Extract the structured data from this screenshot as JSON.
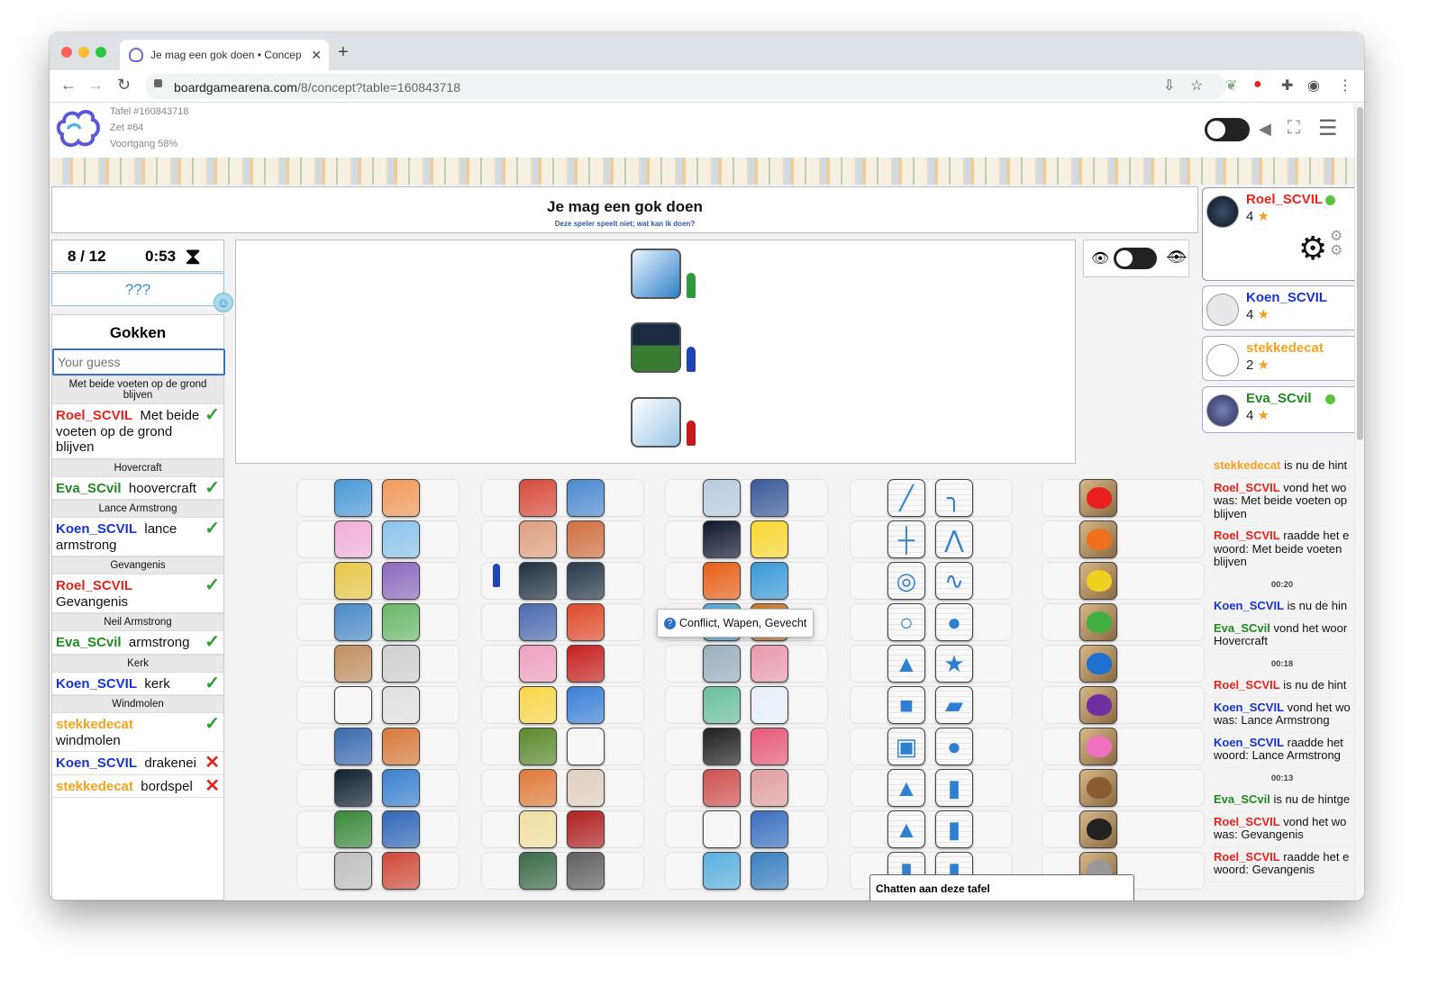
{
  "browser": {
    "tab_title": "Je mag een gok doen • Concep",
    "url_host": "boardgamearena.com",
    "url_path": "/8/concept?table=160843718"
  },
  "header": {
    "table": "Tafel #160843718",
    "move": "Zet #64",
    "progress": "Voortgang 58%"
  },
  "title": {
    "main": "Je mag een gok doen",
    "sub": "Deze speler speelt niet; wat kan ik doen?"
  },
  "timer": {
    "round": "8 / 12",
    "time": "0:53"
  },
  "hint": "???",
  "guess_panel": {
    "title": "Gokken",
    "placeholder": "Your guess",
    "sections": [
      {
        "word": "Met beide voeten op de grond blijven",
        "entries": [
          {
            "player": "Roel_SCVIL",
            "color": "#e8221a",
            "text": "Met beide voeten op de grond blijven",
            "result": "correct"
          }
        ]
      },
      {
        "word": "Hovercraft",
        "entries": [
          {
            "player": "Eva_SCvil",
            "color": "#1f8a1f",
            "text": "hoovercraft",
            "result": "correct"
          }
        ]
      },
      {
        "word": "Lance Armstrong",
        "entries": [
          {
            "player": "Koen_SCVIL",
            "color": "#1634d6",
            "text": "lance armstrong",
            "result": "correct"
          }
        ]
      },
      {
        "word": "Gevangenis",
        "entries": [
          {
            "player": "Roel_SCVIL",
            "color": "#e8221a",
            "text": "Gevangenis",
            "result": "correct"
          }
        ]
      },
      {
        "word": "Neil Armstrong",
        "entries": [
          {
            "player": "Eva_SCvil",
            "color": "#1f8a1f",
            "text": "armstrong",
            "result": "correct"
          }
        ]
      },
      {
        "word": "Kerk",
        "entries": [
          {
            "player": "Koen_SCVIL",
            "color": "#1634d6",
            "text": "kerk",
            "result": "correct"
          }
        ]
      },
      {
        "word": "Windmolen",
        "entries": [
          {
            "player": "stekkedecat",
            "color": "#f7a21b",
            "text": "windmolen",
            "result": "correct"
          },
          {
            "player": "Koen_SCVIL",
            "color": "#1634d6",
            "text": "drakenei",
            "result": "wrong"
          },
          {
            "player": "stekkedecat",
            "color": "#f7a21b",
            "text": "bordspel",
            "result": "wrong"
          }
        ]
      }
    ]
  },
  "tooltip": "Conflict, Wapen, Gevecht",
  "chat_tab": "Chatten aan deze tafel",
  "players": [
    {
      "name": "Roel_SCVIL",
      "color": "#e8221a",
      "score": "4"
    },
    {
      "name": "Koen_SCVIL",
      "color": "#1634d6",
      "score": "4"
    },
    {
      "name": "stekkedecat",
      "color": "#f7a21b",
      "score": "2"
    },
    {
      "name": "Eva_SCvil",
      "color": "#1f8a1f",
      "score": "4"
    }
  ],
  "log": [
    {
      "type": "msg",
      "player": "stekkedecat",
      "color": "#f7a21b",
      "text": " is nu de hint"
    },
    {
      "type": "msg",
      "player": "Roel_SCVIL",
      "color": "#e8221a",
      "text": " vond het wo",
      "text2": "was: Met beide voeten op",
      "text3": "blijven"
    },
    {
      "type": "msg",
      "player": "Roel_SCVIL",
      "color": "#e8221a",
      "text": " raadde het e",
      "text2": "woord: Met beide voeten",
      "text3": "blijven"
    },
    {
      "type": "time",
      "text": "00:20"
    },
    {
      "type": "msg",
      "player": "Koen_SCVIL",
      "color": "#1634d6",
      "text": " is nu de hin"
    },
    {
      "type": "msg",
      "player": "Eva_SCvil",
      "color": "#1f8a1f",
      "text": " vond het woor",
      "text2": "Hovercraft"
    },
    {
      "type": "time",
      "text": "00:18"
    },
    {
      "type": "msg",
      "player": "Roel_SCVIL",
      "color": "#e8221a",
      "text": " is nu de hint"
    },
    {
      "type": "msg",
      "player": "Koen_SCVIL",
      "color": "#1634d6",
      "text": " vond het wo",
      "text2": "was: Lance Armstrong"
    },
    {
      "type": "msg",
      "player": "Koen_SCVIL",
      "color": "#1634d6",
      "text": " raadde het",
      "text2": "woord: Lance Armstrong"
    },
    {
      "type": "time",
      "text": "00:13"
    },
    {
      "type": "msg",
      "player": "Eva_SCvil",
      "color": "#1f8a1f",
      "text": " is nu de hintge"
    },
    {
      "type": "msg",
      "player": "Roel_SCVIL",
      "color": "#e8221a",
      "text": " vond het wo",
      "text2": "was: Gevangenis"
    },
    {
      "type": "msg",
      "player": "Roel_SCVIL",
      "color": "#e8221a",
      "text": " raadde het e",
      "text2": "woord: Gevangenis"
    }
  ],
  "colors": {
    "accent": "#3b74c4",
    "correct": "#2ba12b",
    "wrong": "#e0261d",
    "star": "#f2a020"
  }
}
